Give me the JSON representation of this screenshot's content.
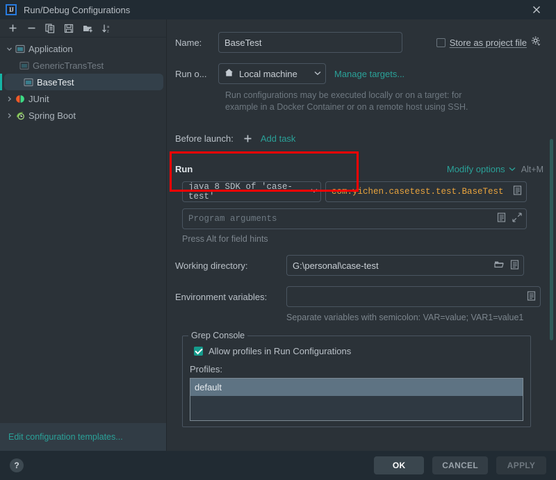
{
  "window": {
    "title": "Run/Debug Configurations",
    "logo_text": "IJ",
    "close_label": "×"
  },
  "toolbar": {
    "items": [
      {
        "name": "add-configuration-button",
        "icon": "plus-icon",
        "label": "+"
      },
      {
        "name": "remove-configuration-button",
        "icon": "minus-icon",
        "label": "−"
      },
      {
        "name": "copy-configuration-button",
        "icon": "copy-icon",
        "label": "Copy"
      },
      {
        "name": "save-configuration-button",
        "icon": "save-icon",
        "label": "Save"
      },
      {
        "name": "new-folder-button",
        "icon": "folder-add-icon",
        "label": "New Folder"
      },
      {
        "name": "sort-configurations-button",
        "icon": "sort-alpha-icon",
        "label": "Sort"
      }
    ]
  },
  "sidebar": {
    "items": [
      {
        "label": "Application",
        "icon": "application-icon",
        "expanded": true,
        "level": 0,
        "state": "group"
      },
      {
        "label": "GenericTransTest",
        "icon": "application-icon",
        "level": 1,
        "state": "dim"
      },
      {
        "label": "BaseTest",
        "icon": "application-icon",
        "level": 1,
        "state": "selected"
      },
      {
        "label": "JUnit",
        "icon": "junit-icon",
        "expanded": false,
        "level": 0,
        "state": "group"
      },
      {
        "label": "Spring Boot",
        "icon": "spring-boot-icon",
        "expanded": false,
        "level": 0,
        "state": "group"
      }
    ],
    "edit_templates_label": "Edit configuration templates..."
  },
  "form": {
    "name_label": "Name:",
    "name_value": "BaseTest",
    "store_as_project_file_label": "Store as project file",
    "store_as_project_file_checked": false,
    "gear_icon": "gear-icon",
    "run_on_label": "Run o...",
    "run_on_value": "Local machine",
    "run_on_icon": "home-icon",
    "manage_targets_label": "Manage targets...",
    "run_on_hint_line1": "Run configurations may be executed locally or on a target: for",
    "run_on_hint_line2": "example in a Docker Container or on a remote host using SSH.",
    "before_launch_label": "Before launch:",
    "before_launch_add_icon": "plus-icon",
    "add_task_label": "Add task",
    "run_section_title": "Run",
    "modify_options_label": "Modify options",
    "modify_options_shortcut": "Alt+M",
    "jre_value": "java 8 SDK of 'case-test'",
    "main_class_value": "com.yichen.casetest.test.BaseTest",
    "program_arguments_placeholder": "Program arguments",
    "field_hint": "Press Alt for field hints",
    "working_directory_label": "Working directory:",
    "working_directory_value": "G:\\personal\\case-test",
    "environment_variables_label": "Environment variables:",
    "environment_variables_value": "",
    "environment_variables_hint": "Separate variables with semicolon: VAR=value; VAR1=value1"
  },
  "grep_console": {
    "legend": "Grep Console",
    "allow_profiles_label": "Allow profiles in Run Configurations",
    "allow_profiles_checked": true,
    "profiles_label": "Profiles:",
    "profiles": [
      "default"
    ]
  },
  "footer": {
    "help_label": "?",
    "ok_label": "OK",
    "cancel_label": "CANCEL",
    "apply_label": "APPLY"
  },
  "annotation": {
    "highlight_color": "#ff0000"
  },
  "colors": {
    "accent_teal": "#2aa198",
    "selection": "#33404a",
    "background": "#2b3238",
    "titlebar": "#212b33",
    "string_orange": "#e8a33d"
  }
}
